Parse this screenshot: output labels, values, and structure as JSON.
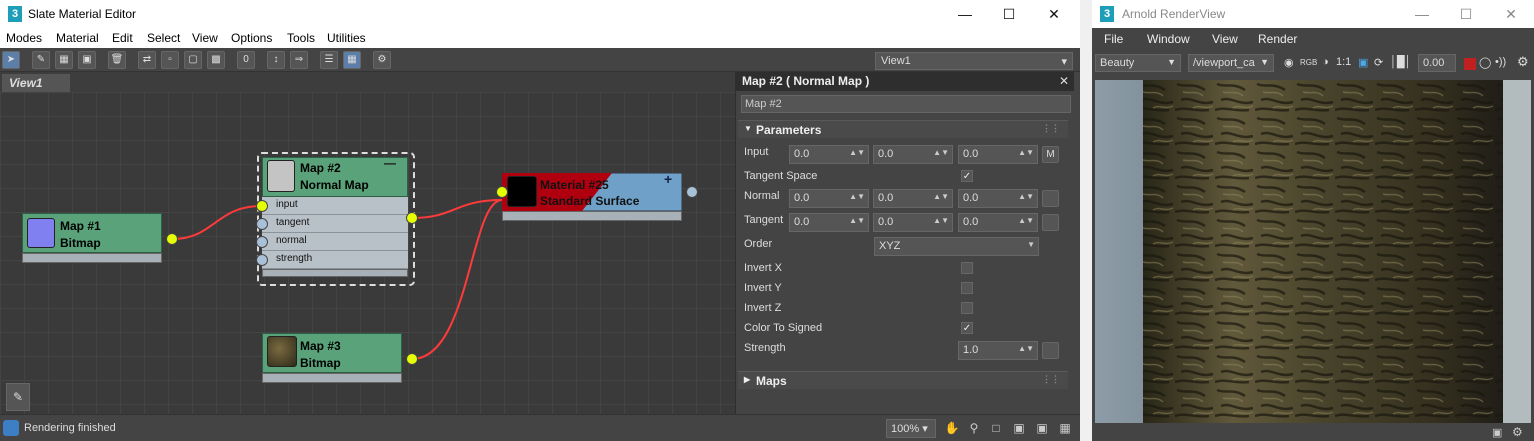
{
  "slate": {
    "title": "Slate Material Editor",
    "menu": [
      "Modes",
      "Material",
      "Edit",
      "Select",
      "View",
      "Options",
      "Tools",
      "Utilities"
    ],
    "view_dropdown": "View1",
    "tab": "View1",
    "status": "Rendering finished",
    "zoom": "100%",
    "nodes": {
      "map1": {
        "line1": "Map #1",
        "line2": "Bitmap"
      },
      "map2": {
        "line1": "Map #2",
        "line2": "Normal Map",
        "slots": [
          "input",
          "tangent",
          "normal",
          "strength"
        ]
      },
      "mat25": {
        "line1": "Material #25",
        "line2": "Standard Surface"
      },
      "map3": {
        "line1": "Map #3",
        "line2": "Bitmap"
      }
    },
    "panel": {
      "title": "Map #2  ( Normal Map )",
      "name_field": "Map #2",
      "parameters_label": "Parameters",
      "maps_label": "Maps",
      "input": {
        "label": "Input",
        "x": "0.0",
        "y": "0.0",
        "z": "0.0",
        "map_btn": "M"
      },
      "tangent_space": {
        "label": "Tangent Space",
        "checked": true
      },
      "normal": {
        "label": "Normal",
        "x": "0.0",
        "y": "0.0",
        "z": "0.0"
      },
      "tangent": {
        "label": "Tangent",
        "x": "0.0",
        "y": "0.0",
        "z": "0.0"
      },
      "order": {
        "label": "Order",
        "value": "XYZ"
      },
      "invert_x": {
        "label": "Invert X",
        "checked": false
      },
      "invert_y": {
        "label": "Invert Y",
        "checked": false
      },
      "invert_z": {
        "label": "Invert Z",
        "checked": false
      },
      "color_to_signed": {
        "label": "Color To Signed",
        "checked": true
      },
      "strength": {
        "label": "Strength",
        "value": "1.0"
      }
    }
  },
  "arnold": {
    "title": "Arnold RenderView",
    "menu": [
      "File",
      "Window",
      "View",
      "Render"
    ],
    "aov": "Beauty",
    "camera": "/viewport_ca",
    "ratio": "1:1",
    "exposure": "0.00"
  },
  "colors": {
    "node_green": "#5aa37a",
    "port_yellow": "#e6ff00",
    "wire_red": "#ff3a3a",
    "material_red": "#b00010",
    "material_blue": "#6fa0c8"
  }
}
